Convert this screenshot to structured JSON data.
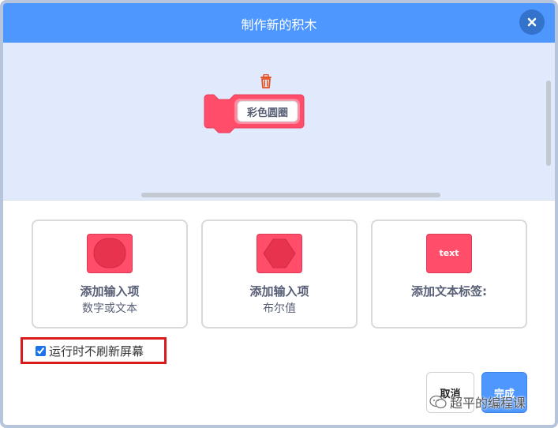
{
  "dialog": {
    "title": "制作新的积木",
    "close_icon": "close-icon"
  },
  "workspace": {
    "block_label": "彩色圆圈",
    "trash_icon": "trash-icon"
  },
  "options": [
    {
      "line1": "添加输入项",
      "line2": "数字或文本",
      "icon": "rounded-input-icon"
    },
    {
      "line1": "添加输入项",
      "line2": "布尔值",
      "icon": "hexagon-input-icon"
    },
    {
      "line1": "添加文本标签:",
      "line2": "",
      "icon_text": "text"
    }
  ],
  "checkbox": {
    "label": "运行时不刷新屏幕",
    "checked": true
  },
  "buttons": {
    "cancel": "取消",
    "done": "完成"
  },
  "watermark": {
    "text": "超平的编程课"
  },
  "colors": {
    "header": "#4d97ff",
    "block": "#ff4d6a",
    "workspace_bg": "#e0eafc",
    "highlight_border": "#d91a1a"
  }
}
